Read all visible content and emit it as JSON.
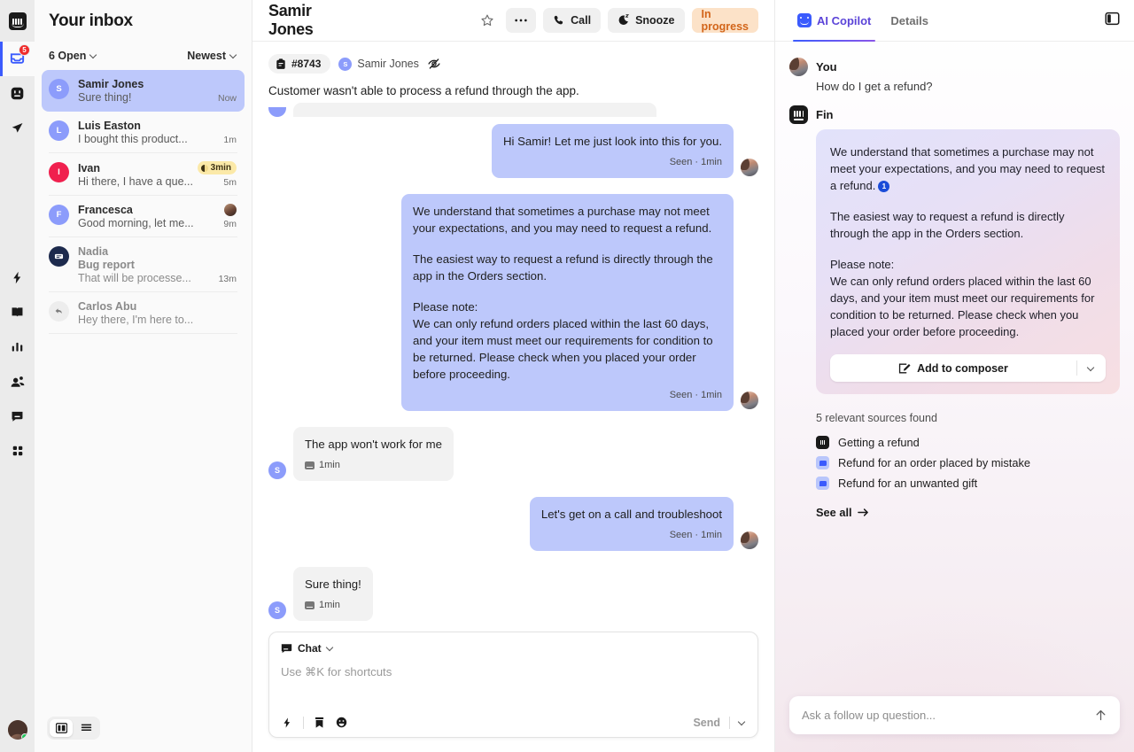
{
  "rail": {
    "logo_name": "intercom-logo",
    "items": [
      {
        "icon": "inbox-icon",
        "badge": "5",
        "active": true
      },
      {
        "icon": "fin-ai-icon",
        "badge": "",
        "active": false
      },
      {
        "icon": "send-outbound-icon",
        "badge": "",
        "active": false
      },
      {
        "icon": "automation-bolt-icon",
        "badge": "",
        "active": false
      },
      {
        "icon": "knowledge-book-icon",
        "badge": "",
        "active": false
      },
      {
        "icon": "reports-chart-icon",
        "badge": "",
        "active": false
      },
      {
        "icon": "contacts-people-icon",
        "badge": "",
        "active": false
      },
      {
        "icon": "messenger-chat-icon",
        "badge": "",
        "active": false
      },
      {
        "icon": "apps-grid-icon",
        "badge": "",
        "active": false
      }
    ],
    "user_avatar": "user-avatar",
    "presence": "online"
  },
  "inbox": {
    "title": "Your inbox",
    "status_filter": "6 Open",
    "sort_filter": "Newest",
    "conversations": [
      {
        "name": "Samir Jones",
        "subject": "",
        "preview": "Sure thing!",
        "time": "Now",
        "initial": "S",
        "avatar_kind": "initial",
        "avatar_color": "#8c9cfb",
        "selected": true,
        "sla": "",
        "agent_avatar": false
      },
      {
        "name": "Luis Easton",
        "subject": "",
        "preview": "I bought this product...",
        "time": "1m",
        "initial": "L",
        "avatar_kind": "initial",
        "avatar_color": "#8c9cfb",
        "selected": false,
        "sla": "",
        "agent_avatar": false
      },
      {
        "name": "Ivan",
        "subject": "",
        "preview": "Hi there, I have a que...",
        "time": "5m",
        "initial": "I",
        "avatar_kind": "initial",
        "avatar_color": "#f0204e",
        "selected": false,
        "sla": "3min",
        "agent_avatar": false
      },
      {
        "name": "Francesca",
        "subject": "",
        "preview": "Good morning, let me...",
        "time": "9m",
        "initial": "F",
        "avatar_kind": "initial",
        "avatar_color": "#8c9cfb",
        "selected": false,
        "sla": "",
        "agent_avatar": true
      },
      {
        "name": "Nadia",
        "subject": "Bug report",
        "preview": "That will be processe...",
        "time": "13m",
        "initial": "",
        "avatar_kind": "ticket",
        "avatar_color": "#1d2a4d",
        "selected": false,
        "sla": "",
        "agent_avatar": false
      },
      {
        "name": "Carlos Abu",
        "subject": "",
        "preview": "Hey there, I'm here to...",
        "time": "",
        "initial": "",
        "avatar_kind": "reply",
        "avatar_color": "#ededed",
        "selected": false,
        "sla": "",
        "agent_avatar": false
      }
    ],
    "view_toggle": {
      "split_view": "split-view-icon",
      "list_view": "list-view-icon"
    }
  },
  "conversation": {
    "title": "Samir Jones",
    "actions": {
      "star": "star-icon",
      "more": "more-options-icon",
      "call": "Call",
      "snooze": "Snooze",
      "status": "In progress"
    },
    "ticket": {
      "id": "#8743",
      "person": "Samir Jones",
      "initial": "S",
      "visibility_icon": "eye-off-icon",
      "summary": "Customer wasn't able to process a refund through the app."
    },
    "messages": [
      {
        "direction": "out",
        "paragraphs": [
          "Hi Samir! Let me just look into this for you."
        ],
        "meta": "Seen · 1min",
        "meta_icon": ""
      },
      {
        "direction": "out",
        "paragraphs": [
          "We understand that sometimes a purchase may not meet your expectations, and you may need to request a refund.",
          "The easiest way to request a refund is directly through the app in the Orders section.",
          "Please note:",
          "We can only refund orders placed within the last 60 days, and your item must meet our requirements for condition to be returned. Please check when you placed your order before proceeding."
        ],
        "meta": "Seen · 1min",
        "meta_icon": ""
      },
      {
        "direction": "in",
        "paragraphs": [
          "The app won't work for me"
        ],
        "meta": "1min",
        "meta_icon": "chat-source-icon"
      },
      {
        "direction": "out",
        "paragraphs": [
          "Let's get on a call and troubleshoot"
        ],
        "meta": "Seen · 1min",
        "meta_icon": ""
      },
      {
        "direction": "in",
        "paragraphs": [
          "Sure thing!"
        ],
        "meta": "1min",
        "meta_icon": "chat-source-icon"
      }
    ],
    "composer": {
      "type_label": "Chat",
      "placeholder": "Use ⌘K for shortcuts",
      "tools": [
        "shortcuts-bolt-icon",
        "saved-reply-icon",
        "emoji-icon"
      ],
      "send_label": "Send"
    }
  },
  "copilot": {
    "tabs": [
      {
        "label": "AI Copilot",
        "active": true,
        "icon": "fin-copilot-icon"
      },
      {
        "label": "Details",
        "active": false,
        "icon": ""
      }
    ],
    "expand_icon": "panel-toggle-icon",
    "user": {
      "name": "You",
      "question": "How do I get a refund?"
    },
    "assistant": {
      "name": "Fin",
      "paragraphs": [
        "We understand that sometimes a purchase may not meet your expectations, and you may need to request a refund.",
        "The easiest way to request a refund is directly through the app in the Orders section.",
        "Please note:",
        "We can only refund orders placed within the last 60 days, and your item must meet our requirements for condition to be returned. Please check when you placed your order before proceeding."
      ],
      "citation": "1",
      "add_to_composer": "Add to composer"
    },
    "sources": {
      "title": "5 relevant sources found",
      "items": [
        {
          "label": "Getting a refund",
          "icon": "fin-source-icon"
        },
        {
          "label": "Refund for an order placed by mistake",
          "icon": "article-source-icon"
        },
        {
          "label": "Refund for an unwanted gift",
          "icon": "article-source-icon"
        }
      ],
      "see_all": "See all"
    },
    "follow_up_placeholder": "Ask a follow up question...",
    "send_icon": "arrow-up-icon"
  },
  "colors": {
    "accent_blue": "#3b5bfd",
    "copilot_purple": "#5b44d8",
    "bubble_out": "#bdc8fb",
    "bubble_in": "#f2f2f2",
    "status_badge_bg": "#fce2c8",
    "status_badge_fg": "#d2651a",
    "sla_badge_bg": "#fbe9a8",
    "badge_red": "#ef2b2b",
    "online_green": "#1ec95b"
  }
}
